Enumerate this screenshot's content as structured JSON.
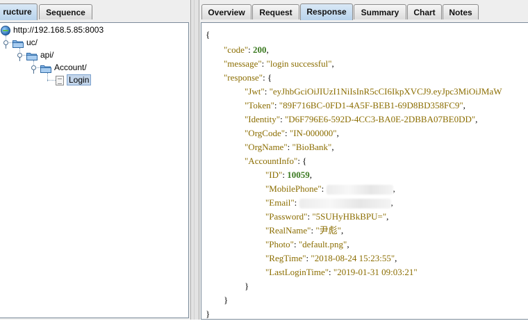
{
  "left_tabs": [
    "ructure",
    "Sequence"
  ],
  "tree": {
    "host": "http://192.168.5.85:8003",
    "uc": "uc/",
    "api": "api/",
    "account": "Account/",
    "login": "Login"
  },
  "right_tabs": [
    "Overview",
    "Request",
    "Response",
    "Summary",
    "Chart",
    "Notes"
  ],
  "active_right_tab": "Response",
  "json": {
    "open": "{",
    "code_key": "\"code\"",
    "code_val": "200",
    "message_key": "\"message\"",
    "message_val": "\"login successful\"",
    "response_key": "\"response\"",
    "jwt_key": "\"Jwt\"",
    "jwt_val": "\"eyJhbGciOiJIUzI1NiIsInR5cCI6IkpXVCJ9.eyJpc3MiOiJMaW",
    "token_key": "\"Token\"",
    "token_val": "\"89F716BC-0FD1-4A5F-BEB1-69D8BD358FC9\"",
    "identity_key": "\"Identity\"",
    "identity_val": "\"D6F796E6-592D-4CC3-BA0E-2DBBA07BE0DD\"",
    "orgcode_key": "\"OrgCode\"",
    "orgcode_val": "\"IN-000000\"",
    "orgname_key": "\"OrgName\"",
    "orgname_val": "\"BioBank\"",
    "accountinfo_key": "\"AccountInfo\"",
    "id_key": "\"ID\"",
    "id_val": "10059",
    "mobile_key": "\"MobilePhone\"",
    "email_key": "\"Email\"",
    "password_key": "\"Password\"",
    "password_val": "\"5SUHyHBkBPU=\"",
    "realname_key": "\"RealName\"",
    "realname_val": "\"尹彪\"",
    "photo_key": "\"Photo\"",
    "photo_val": "\"default.png\"",
    "regtime_key": "\"RegTime\"",
    "regtime_val": "\"2018-08-24 15:23:55\"",
    "lastlogin_key": "\"LastLoginTime\"",
    "lastlogin_val": "\"2019-01-31 09:03:21\"",
    "close": "}"
  },
  "colors": {
    "key": "#8b6d00",
    "number": "#3c7a22",
    "tab_active": "#b8d3ec",
    "selection": "#c3d5ea"
  }
}
